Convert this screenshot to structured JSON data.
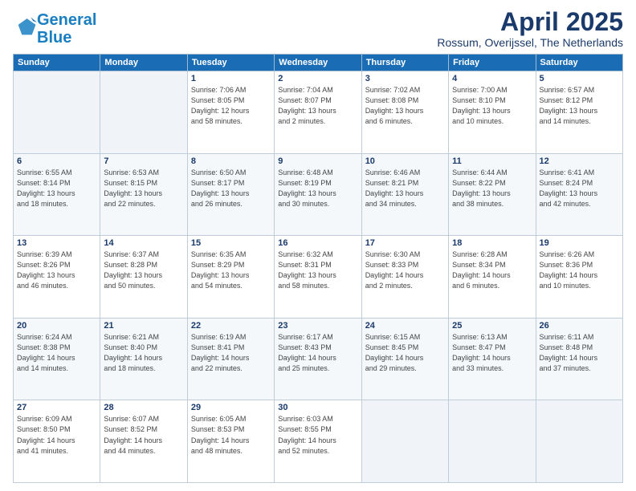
{
  "header": {
    "logo_line1": "General",
    "logo_line2": "Blue",
    "month": "April 2025",
    "location": "Rossum, Overijssel, The Netherlands"
  },
  "weekdays": [
    "Sunday",
    "Monday",
    "Tuesday",
    "Wednesday",
    "Thursday",
    "Friday",
    "Saturday"
  ],
  "weeks": [
    [
      {
        "day": "",
        "info": ""
      },
      {
        "day": "",
        "info": ""
      },
      {
        "day": "1",
        "info": "Sunrise: 7:06 AM\nSunset: 8:05 PM\nDaylight: 12 hours\nand 58 minutes."
      },
      {
        "day": "2",
        "info": "Sunrise: 7:04 AM\nSunset: 8:07 PM\nDaylight: 13 hours\nand 2 minutes."
      },
      {
        "day": "3",
        "info": "Sunrise: 7:02 AM\nSunset: 8:08 PM\nDaylight: 13 hours\nand 6 minutes."
      },
      {
        "day": "4",
        "info": "Sunrise: 7:00 AM\nSunset: 8:10 PM\nDaylight: 13 hours\nand 10 minutes."
      },
      {
        "day": "5",
        "info": "Sunrise: 6:57 AM\nSunset: 8:12 PM\nDaylight: 13 hours\nand 14 minutes."
      }
    ],
    [
      {
        "day": "6",
        "info": "Sunrise: 6:55 AM\nSunset: 8:14 PM\nDaylight: 13 hours\nand 18 minutes."
      },
      {
        "day": "7",
        "info": "Sunrise: 6:53 AM\nSunset: 8:15 PM\nDaylight: 13 hours\nand 22 minutes."
      },
      {
        "day": "8",
        "info": "Sunrise: 6:50 AM\nSunset: 8:17 PM\nDaylight: 13 hours\nand 26 minutes."
      },
      {
        "day": "9",
        "info": "Sunrise: 6:48 AM\nSunset: 8:19 PM\nDaylight: 13 hours\nand 30 minutes."
      },
      {
        "day": "10",
        "info": "Sunrise: 6:46 AM\nSunset: 8:21 PM\nDaylight: 13 hours\nand 34 minutes."
      },
      {
        "day": "11",
        "info": "Sunrise: 6:44 AM\nSunset: 8:22 PM\nDaylight: 13 hours\nand 38 minutes."
      },
      {
        "day": "12",
        "info": "Sunrise: 6:41 AM\nSunset: 8:24 PM\nDaylight: 13 hours\nand 42 minutes."
      }
    ],
    [
      {
        "day": "13",
        "info": "Sunrise: 6:39 AM\nSunset: 8:26 PM\nDaylight: 13 hours\nand 46 minutes."
      },
      {
        "day": "14",
        "info": "Sunrise: 6:37 AM\nSunset: 8:28 PM\nDaylight: 13 hours\nand 50 minutes."
      },
      {
        "day": "15",
        "info": "Sunrise: 6:35 AM\nSunset: 8:29 PM\nDaylight: 13 hours\nand 54 minutes."
      },
      {
        "day": "16",
        "info": "Sunrise: 6:32 AM\nSunset: 8:31 PM\nDaylight: 13 hours\nand 58 minutes."
      },
      {
        "day": "17",
        "info": "Sunrise: 6:30 AM\nSunset: 8:33 PM\nDaylight: 14 hours\nand 2 minutes."
      },
      {
        "day": "18",
        "info": "Sunrise: 6:28 AM\nSunset: 8:34 PM\nDaylight: 14 hours\nand 6 minutes."
      },
      {
        "day": "19",
        "info": "Sunrise: 6:26 AM\nSunset: 8:36 PM\nDaylight: 14 hours\nand 10 minutes."
      }
    ],
    [
      {
        "day": "20",
        "info": "Sunrise: 6:24 AM\nSunset: 8:38 PM\nDaylight: 14 hours\nand 14 minutes."
      },
      {
        "day": "21",
        "info": "Sunrise: 6:21 AM\nSunset: 8:40 PM\nDaylight: 14 hours\nand 18 minutes."
      },
      {
        "day": "22",
        "info": "Sunrise: 6:19 AM\nSunset: 8:41 PM\nDaylight: 14 hours\nand 22 minutes."
      },
      {
        "day": "23",
        "info": "Sunrise: 6:17 AM\nSunset: 8:43 PM\nDaylight: 14 hours\nand 25 minutes."
      },
      {
        "day": "24",
        "info": "Sunrise: 6:15 AM\nSunset: 8:45 PM\nDaylight: 14 hours\nand 29 minutes."
      },
      {
        "day": "25",
        "info": "Sunrise: 6:13 AM\nSunset: 8:47 PM\nDaylight: 14 hours\nand 33 minutes."
      },
      {
        "day": "26",
        "info": "Sunrise: 6:11 AM\nSunset: 8:48 PM\nDaylight: 14 hours\nand 37 minutes."
      }
    ],
    [
      {
        "day": "27",
        "info": "Sunrise: 6:09 AM\nSunset: 8:50 PM\nDaylight: 14 hours\nand 41 minutes."
      },
      {
        "day": "28",
        "info": "Sunrise: 6:07 AM\nSunset: 8:52 PM\nDaylight: 14 hours\nand 44 minutes."
      },
      {
        "day": "29",
        "info": "Sunrise: 6:05 AM\nSunset: 8:53 PM\nDaylight: 14 hours\nand 48 minutes."
      },
      {
        "day": "30",
        "info": "Sunrise: 6:03 AM\nSunset: 8:55 PM\nDaylight: 14 hours\nand 52 minutes."
      },
      {
        "day": "",
        "info": ""
      },
      {
        "day": "",
        "info": ""
      },
      {
        "day": "",
        "info": ""
      }
    ]
  ]
}
